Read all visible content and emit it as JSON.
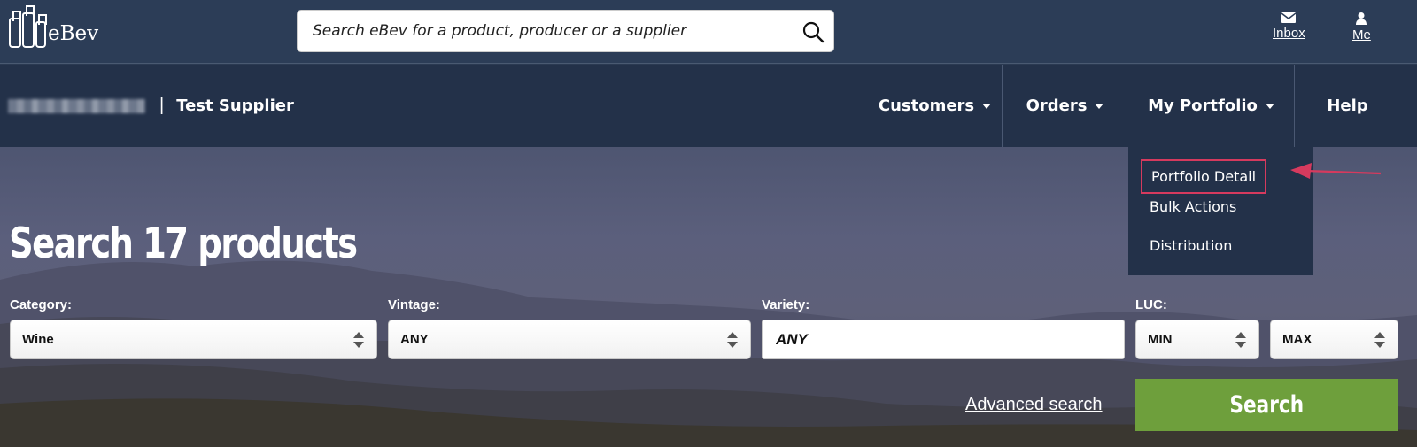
{
  "header": {
    "logo_text": "eBev",
    "search_placeholder": "Search eBev for a product, producer or a supplier",
    "inbox_label": "Inbox",
    "me_label": "Me",
    "icons": [
      "search-icon",
      "envelope-icon",
      "user-icon",
      "bottles-logo-icon"
    ]
  },
  "account": {
    "separator": "|",
    "name": "Test Supplier"
  },
  "nav": {
    "customers": "Customers",
    "orders": "Orders",
    "portfolio": "My Portfolio",
    "help": "Help"
  },
  "portfolio_menu": {
    "items": [
      "Portfolio Detail",
      "Bulk Actions",
      "Distribution"
    ],
    "highlight_color": "#d63a5e"
  },
  "search_panel": {
    "title": "Search 17 products",
    "category_label": "Category:",
    "category_value": "Wine",
    "vintage_label": "Vintage:",
    "vintage_value": "ANY",
    "variety_label": "Variety:",
    "variety_placeholder": "ANY",
    "luc_label": "LUC:",
    "luc_min": "MIN",
    "luc_max": "MAX",
    "advanced_link": "Advanced search",
    "search_button": "Search",
    "button_color": "#6e9f3c"
  }
}
